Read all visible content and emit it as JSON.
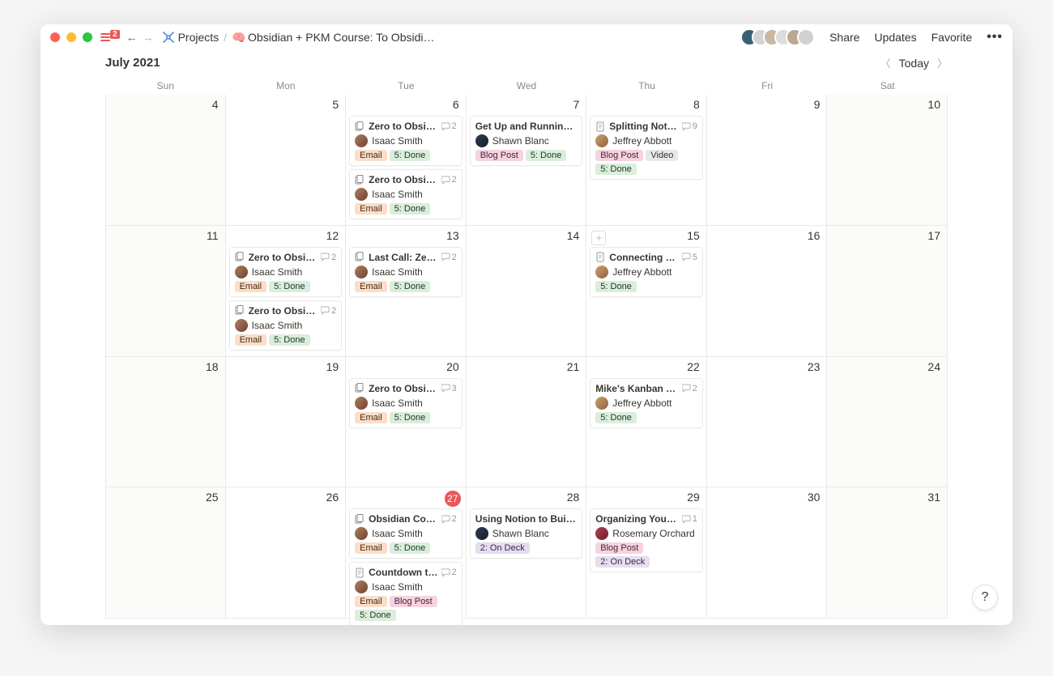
{
  "titlebar": {
    "notification_count": "2",
    "breadcrumb": {
      "root": "Projects",
      "page": "Obsidian + PKM Course: To Obsidi…"
    },
    "actions": {
      "share": "Share",
      "updates": "Updates",
      "favorite": "Favorite"
    }
  },
  "subheader": {
    "month": "July 2021",
    "today": "Today"
  },
  "days": [
    "Sun",
    "Mon",
    "Tue",
    "Wed",
    "Thu",
    "Fri",
    "Sat"
  ],
  "weeks": [
    [
      {
        "num": "4",
        "weekend": true,
        "cards": []
      },
      {
        "num": "5",
        "cards": []
      },
      {
        "num": "6",
        "cards": [
          {
            "title": "Zero to Obsidian…",
            "icon": "multi",
            "comments": "2",
            "assignee": "Isaac Smith",
            "avatar": "isaac",
            "tags": [
              "Email",
              "5: Done"
            ]
          },
          {
            "title": "Zero to Obsidian…",
            "icon": "multi",
            "comments": "2",
            "assignee": "Isaac Smith",
            "avatar": "isaac",
            "tags": [
              "Email",
              "5: Done"
            ]
          }
        ]
      },
      {
        "num": "7",
        "cards": [
          {
            "title": "Get Up and Running Wit…",
            "icon": "",
            "comments": "",
            "assignee": "Shawn Blanc",
            "avatar": "shawn",
            "tags": [
              "Blog Post",
              "5: Done"
            ]
          }
        ]
      },
      {
        "num": "8",
        "cards": [
          {
            "title": "Splitting Notes i…",
            "icon": "doc",
            "comments": "9",
            "assignee": "Jeffrey Abbott",
            "avatar": "jeffrey",
            "tags": [
              "Blog Post",
              "Video",
              "5: Done"
            ]
          }
        ]
      },
      {
        "num": "9",
        "cards": []
      },
      {
        "num": "10",
        "weekend": true,
        "cards": []
      }
    ],
    [
      {
        "num": "11",
        "weekend": true,
        "cards": []
      },
      {
        "num": "12",
        "cards": [
          {
            "title": "Zero to Obsidian…",
            "icon": "multi",
            "comments": "2",
            "assignee": "Isaac Smith",
            "avatar": "isaac",
            "tags": [
              "Email",
              "5: Done"
            ]
          },
          {
            "title": "Zero to Obsidian…",
            "icon": "multi",
            "comments": "2",
            "assignee": "Isaac Smith",
            "avatar": "isaac",
            "tags": [
              "Email",
              "5: Done"
            ]
          }
        ]
      },
      {
        "num": "13",
        "cards": [
          {
            "title": "Last Call: Zero t…",
            "icon": "multi",
            "comments": "2",
            "assignee": "Isaac Smith",
            "avatar": "isaac",
            "tags": [
              "Email",
              "5: Done"
            ]
          }
        ]
      },
      {
        "num": "14",
        "cards": []
      },
      {
        "num": "15",
        "showAdd": true,
        "cards": [
          {
            "title": "Connecting Notes",
            "icon": "doc",
            "comments": "5",
            "assignee": "Jeffrey Abbott",
            "avatar": "jeffrey",
            "tags": [
              "5: Done"
            ]
          }
        ]
      },
      {
        "num": "16",
        "cards": []
      },
      {
        "num": "17",
        "weekend": true,
        "cards": []
      }
    ],
    [
      {
        "num": "18",
        "weekend": true,
        "cards": []
      },
      {
        "num": "19",
        "cards": []
      },
      {
        "num": "20",
        "cards": [
          {
            "title": "Zero to Obsidian…",
            "icon": "multi",
            "comments": "3",
            "assignee": "Isaac Smith",
            "avatar": "isaac",
            "tags": [
              "Email",
              "5: Done"
            ]
          }
        ]
      },
      {
        "num": "21",
        "cards": []
      },
      {
        "num": "22",
        "cards": [
          {
            "title": "Mike's Kanban Writ…",
            "icon": "",
            "comments": "2",
            "assignee": "Jeffrey Abbott",
            "avatar": "jeffrey",
            "tags": [
              "5: Done"
            ]
          }
        ]
      },
      {
        "num": "23",
        "cards": []
      },
      {
        "num": "24",
        "weekend": true,
        "cards": []
      }
    ],
    [
      {
        "num": "25",
        "weekend": true,
        "cards": []
      },
      {
        "num": "26",
        "cards": []
      },
      {
        "num": "27",
        "today": true,
        "cards": [
          {
            "title": "Obsidian Course…",
            "icon": "multi",
            "comments": "2",
            "assignee": "Isaac Smith",
            "avatar": "isaac",
            "tags": [
              "Email",
              "5: Done"
            ]
          },
          {
            "title": "Countdown to P…",
            "icon": "doc",
            "comments": "2",
            "assignee": "Isaac Smith",
            "avatar": "isaac",
            "tags": [
              "Email",
              "Blog Post",
              "5: Done"
            ]
          }
        ]
      },
      {
        "num": "28",
        "cards": [
          {
            "title": "Using Notion to Build O…",
            "icon": "",
            "comments": "",
            "assignee": "Shawn Blanc",
            "avatar": "shawn",
            "tags": [
              "2: On Deck"
            ]
          }
        ]
      },
      {
        "num": "29",
        "cards": [
          {
            "title": "Organizing Your Ob…",
            "icon": "",
            "comments": "1",
            "assignee": "Rosemary Orchard",
            "avatar": "rosemary",
            "tags": [
              "Blog Post",
              "2: On Deck"
            ]
          }
        ]
      },
      {
        "num": "30",
        "cards": []
      },
      {
        "num": "31",
        "weekend": true,
        "cards": []
      }
    ]
  ],
  "tag_classes": {
    "Email": "tag-email",
    "5: Done": "tag-done",
    "Blog Post": "tag-blogpost",
    "Video": "tag-video",
    "2: On Deck": "tag-ondeck"
  },
  "avatar_colors": [
    "#3a6073",
    "#d3d3d3",
    "#c9b7a0",
    "#dcdcdc",
    "#b8a890",
    "#d0d0d0"
  ]
}
